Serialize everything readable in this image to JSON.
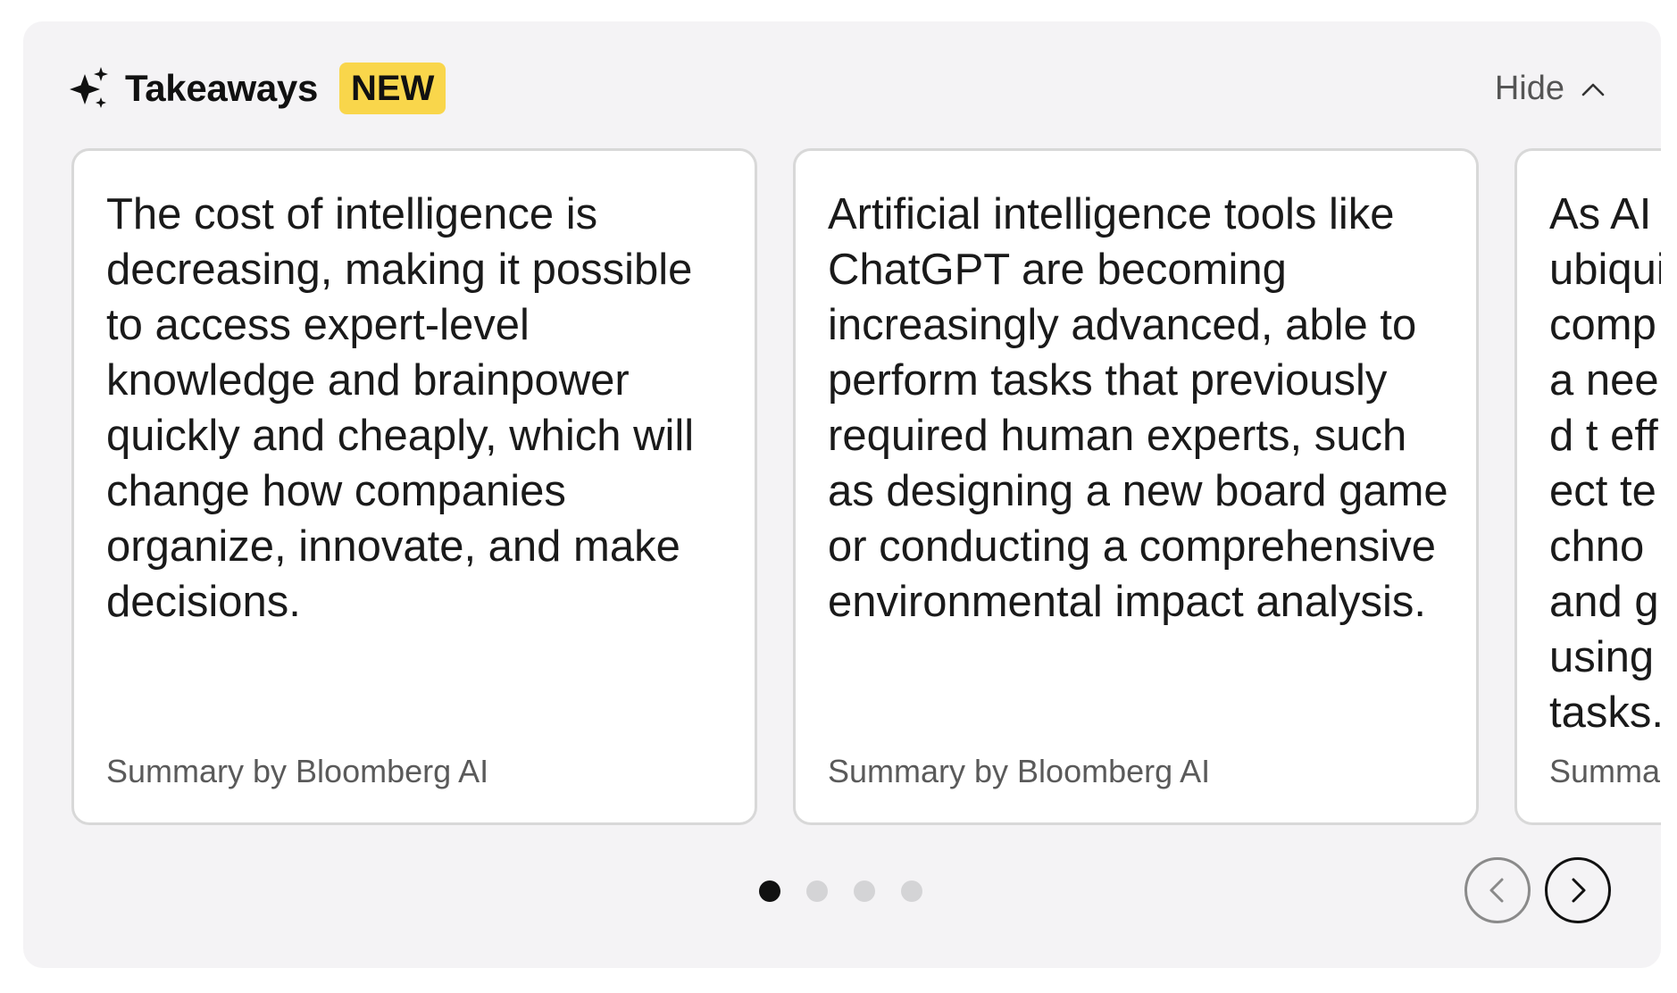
{
  "header": {
    "title": "Takeaways",
    "badge": "NEW",
    "hide_label": "Hide",
    "icon": "sparkle-icon",
    "toggle_icon": "chevron-up-icon"
  },
  "cards": [
    {
      "text": "The cost of intelligence is decreasing, making it possible to access expert-level knowledge and brainpower quickly and cheaply, which will change how companies organize, innovate, and make decisions.",
      "footer": "Summary by Bloomberg AI"
    },
    {
      "text": "Artificial intelligence tools like ChatGPT are becoming increasingly advanced, able to perform tasks that previously required human experts, such as designing a new board game or conducting a comprehensive environmental impact analysis.",
      "footer": "Summary by Bloomberg AI"
    },
    {
      "text": "As AI ubiqui compa need t effect techno and gr using tasks.",
      "footer": "Summar"
    }
  ],
  "pagination": {
    "total": 4,
    "active_index": 0
  },
  "nav": {
    "prev_icon": "chevron-left-icon",
    "next_icon": "chevron-right-icon"
  },
  "colors": {
    "panel_background": "#f4f3f5",
    "badge_background": "#f9d64b",
    "active_dot": "#111111",
    "inactive_dot": "#d4d4d6"
  }
}
